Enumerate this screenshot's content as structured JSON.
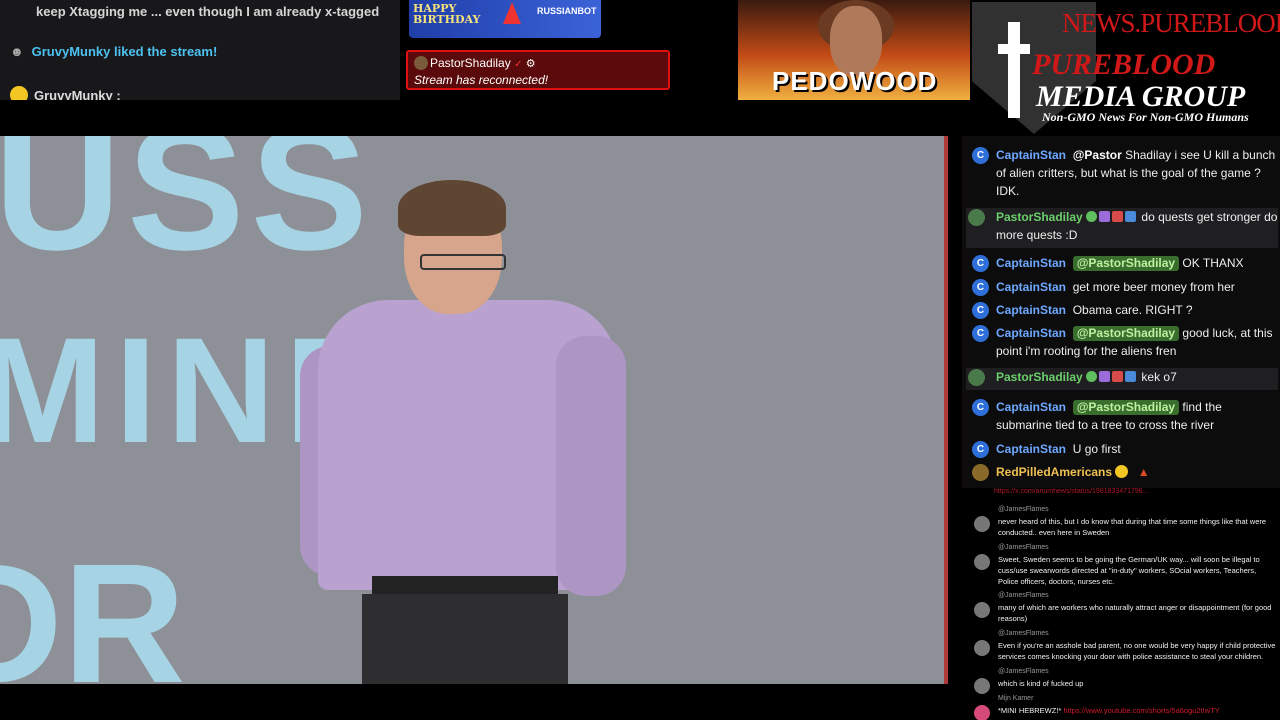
{
  "top_chat": {
    "line1": "keep Xtagging me ... even though I am already x-tagged",
    "line2_user": "GruvyMunky",
    "line2_text": " liked the stream!",
    "line3_user": "GruvyMunky",
    "line3_text": " :"
  },
  "birthday_banner": {
    "line1": "HAPPY",
    "line2": "BIRTHDAY",
    "bot": "RUSSIANBOT"
  },
  "reconnect": {
    "user": "PastorShadilay",
    "message": "Stream has reconnected!"
  },
  "thumbnail": {
    "text": "PEDOWOOD"
  },
  "brand": {
    "url": "NEWS.PUREBLOOD.MEDIA",
    "line1": "PUREBLOOD",
    "line2": "MEDIA GROUP",
    "tagline": "Non-GMO News For Non-GMO Humans"
  },
  "video": {
    "bg_word1": "USS",
    "bg_word2": "MINDED",
    "bg_word3": "DR"
  },
  "chat": [
    {
      "user": "CaptainStan",
      "mention": "@Pastor",
      "mention_style": "plain",
      "text": " Shadilay i see U kill a bunch of alien critters, but what is the goal of the game ? IDK."
    },
    {
      "user": "PastorShadilay",
      "mention": "",
      "text": "do quests get stronger do more quests :D",
      "badges": true
    },
    {
      "user": "CaptainStan",
      "mention": "@PastorShadilay",
      "text": " OK THANX"
    },
    {
      "user": "CaptainStan",
      "mention": "",
      "text": "get more beer money from her"
    },
    {
      "user": "CaptainStan",
      "mention": "",
      "text": "Obama care. RIGHT ?"
    },
    {
      "user": "CaptainStan",
      "mention": "@PastorShadilay",
      "text": " good luck, at this point i'm rooting for the aliens fren"
    },
    {
      "user": "PastorShadilay",
      "mention": "",
      "text": "kek o7",
      "badges": true
    },
    {
      "user": "CaptainStan",
      "mention": "@PastorShadilay",
      "text": " find the submarine tied to a tree to cross the river"
    },
    {
      "user": "CaptainStan",
      "mention": "",
      "text": "U go first"
    },
    {
      "user": "RedPilledAmericans",
      "mention": "",
      "text": ""
    }
  ],
  "overlay_chat": {
    "link_top": "https://x.com/ariumhews/status/1981833471796...",
    "items": [
      {
        "user": "@JamesFlames",
        "text": "never heard of this, but I do know that during that time some things like that were conducted.. even here in Sweden"
      },
      {
        "user": "@JamesFlames",
        "text": "Sweet, Sweden seems to be going the German/UK way... will soon be illegal to cuss/use swearwords directed at \"in-duty\" workers, SOcial workers, Teachers, Police officers, doctors, nurses etc."
      },
      {
        "user": "@JamesFlames",
        "text": "many of which are workers who naturally attract anger or disappointment (for good reasons)"
      },
      {
        "user": "@JamesFlames",
        "text": "Even if you're an asshole bad parent, no one would be very happy if child protective services comes knocking your door with police assistance to steal your children."
      },
      {
        "user": "@JamesFlames",
        "text": "which is kind of fucked up"
      },
      {
        "user": "Mijn Kamer",
        "text": "*MINI HEBREWZ!*",
        "link": "https://www.youtube.com/shorts/5a6ogu2tIwTY"
      }
    ]
  }
}
